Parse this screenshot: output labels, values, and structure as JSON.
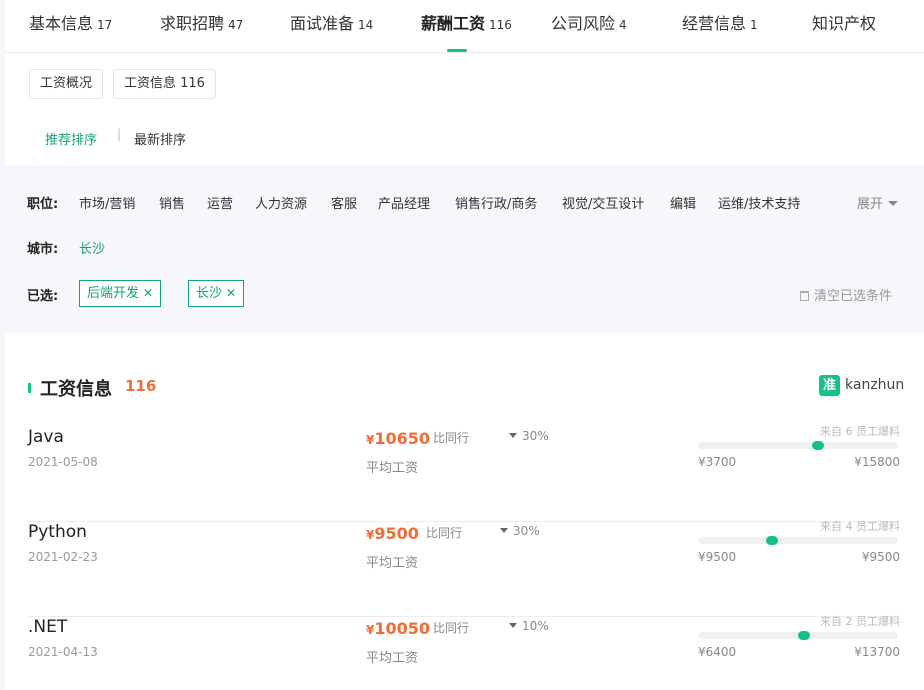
{
  "tabs": [
    {
      "label": "基本信息",
      "count": "17"
    },
    {
      "label": "求职招聘",
      "count": "47"
    },
    {
      "label": "面试准备",
      "count": "14"
    },
    {
      "label": "薪酬工资",
      "count": "116"
    },
    {
      "label": "公司风险",
      "count": "4"
    },
    {
      "label": "经营信息",
      "count": "1"
    },
    {
      "label": "知识产权",
      "count": ""
    }
  ],
  "subtabs": {
    "overview": "工资概况",
    "info": "工资信息 116"
  },
  "sort": {
    "recommended": "推荐排序",
    "latest": "最新排序",
    "separator": "|"
  },
  "filter": {
    "position_label": "职位:",
    "positions": [
      "市场/营销",
      "销售",
      "运营",
      "人力资源",
      "客服",
      "产品经理",
      "销售行政/商务",
      "视觉/交互设计",
      "编辑",
      "运维/技术支持"
    ],
    "expand": "展开",
    "city_label": "城市:",
    "city": "长沙",
    "selected_label": "已选:",
    "selected": [
      {
        "label": "后端开发",
        "close": "✕"
      },
      {
        "label": "长沙",
        "close": "✕"
      }
    ],
    "clear": "清空已选条件"
  },
  "list": {
    "title": "工资信息",
    "count": "116",
    "logo_char": "准",
    "logo_text": "kanzhun",
    "compare_label": "比同行",
    "avg_label": "平均工资",
    "currency": "¥",
    "rows": [
      {
        "job": "Java",
        "date": "2021-05-08",
        "avg": "10650",
        "pct": "30%",
        "source": "来自 6 员工爆料",
        "min": "¥3700",
        "max": "¥15800",
        "level": 0.6
      },
      {
        "job": "Python",
        "date": "2021-02-23",
        "avg": "9500",
        "pct": "30%",
        "source": "来自 4 员工爆料",
        "min": "¥9500",
        "max": "¥9500",
        "level": 0.37
      },
      {
        "job": ".NET",
        "date": "2021-04-13",
        "avg": "10050",
        "pct": "10%",
        "source": "来自 2 员工爆料",
        "min": "¥6400",
        "max": "¥13700",
        "level": 0.53
      }
    ]
  },
  "colors": {
    "accent": "#14c18a",
    "accent_text": "#14a37a",
    "salary": "#f26d35"
  }
}
